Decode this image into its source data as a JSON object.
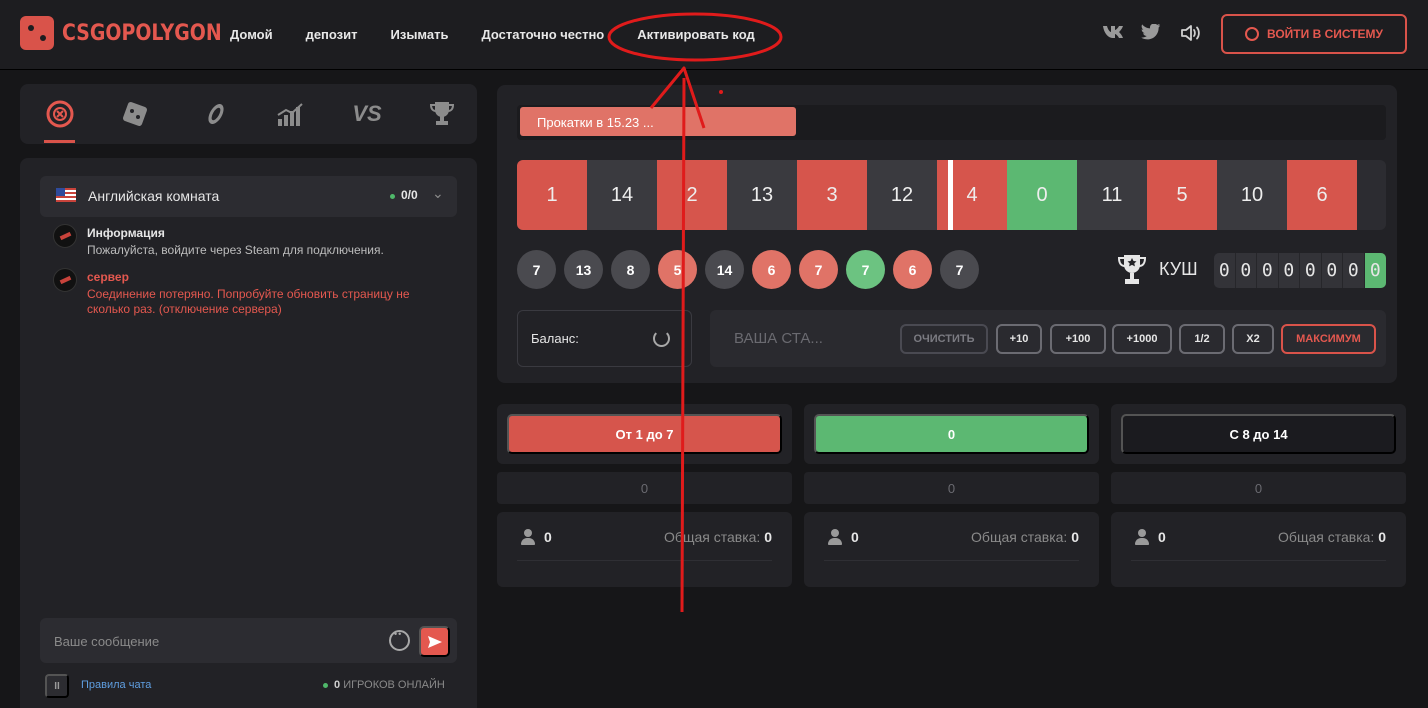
{
  "header": {
    "logo_text": "CSGOPOLYGON",
    "nav": [
      "Домой",
      "депозит",
      "Изымать",
      "Достаточно честно",
      "Активировать код"
    ],
    "social": {
      "vk": "vk-icon",
      "twitter": "twitter-icon",
      "sound": "speaker-icon"
    },
    "login_label": "ВОЙТИ В СИСТЕМУ"
  },
  "games_nav": [
    "roulette-icon",
    "dice-icon",
    "coinflip-icon",
    "crash-icon",
    "versus-icon",
    "trophy-icon"
  ],
  "chat": {
    "room_name": "Английская комната",
    "room_count": "0/0",
    "messages": [
      {
        "author": "Информация",
        "text": "Пожалуйста, войдите через Steam для подключения."
      },
      {
        "author": "сервер",
        "text": "Соединение потеряно. Попробуйте обновить страницу не сколько раз. (отключение сервера)"
      }
    ],
    "input_placeholder": "Ваше сообщение",
    "rules_label": "Правила чата",
    "online_count": "0",
    "online_label": "ИГРОКОВ ОНЛАЙН"
  },
  "roulette": {
    "progress_text": "Прокатки в 15.23 ...",
    "progress_fraction": 0.32,
    "strip": [
      {
        "n": "1",
        "c": "red"
      },
      {
        "n": "14",
        "c": "dark"
      },
      {
        "n": "2",
        "c": "red"
      },
      {
        "n": "13",
        "c": "dark"
      },
      {
        "n": "3",
        "c": "red"
      },
      {
        "n": "12",
        "c": "dark"
      },
      {
        "n": "4",
        "c": "red"
      },
      {
        "n": "0",
        "c": "green"
      },
      {
        "n": "11",
        "c": "dark"
      },
      {
        "n": "5",
        "c": "red"
      },
      {
        "n": "10",
        "c": "dark"
      },
      {
        "n": "6",
        "c": "red"
      }
    ],
    "history": [
      {
        "n": "7",
        "c": "dark"
      },
      {
        "n": "13",
        "c": "dark"
      },
      {
        "n": "8",
        "c": "dark"
      },
      {
        "n": "5",
        "c": "red"
      },
      {
        "n": "14",
        "c": "dark"
      },
      {
        "n": "6",
        "c": "red"
      },
      {
        "n": "7",
        "c": "red"
      },
      {
        "n": "7",
        "c": "green"
      },
      {
        "n": "6",
        "c": "red"
      },
      {
        "n": "7",
        "c": "dark"
      }
    ],
    "jackpot_label": "КУШ",
    "jackpot_digits": [
      "0",
      "0",
      "0",
      "0",
      "0",
      "0",
      "0",
      "0"
    ],
    "balance_label": "Баланс:",
    "bet_placeholder": "ВАША СТА...",
    "buttons": {
      "clear": "ОЧИСТИТЬ",
      "p10": "+10",
      "p100": "+100",
      "p1000": "+1000",
      "half": "1/2",
      "double": "X2",
      "max": "МАКСИМУМ"
    }
  },
  "columns": [
    {
      "label": "От 1 до 7",
      "color": "red",
      "total": "0",
      "players": "0",
      "bet_label": "Общая ставка:",
      "bet_value": "0"
    },
    {
      "label": "0",
      "color": "green",
      "total": "0",
      "players": "0",
      "bet_label": "Общая ставка:",
      "bet_value": "0"
    },
    {
      "label": "С 8 до 14",
      "color": "dark",
      "total": "0",
      "players": "0",
      "bet_label": "Общая ставка:",
      "bet_value": "0"
    }
  ],
  "colors": {
    "accent_red": "#d9534a",
    "green": "#5cb872",
    "bg": "#161618",
    "panel": "#222226"
  }
}
